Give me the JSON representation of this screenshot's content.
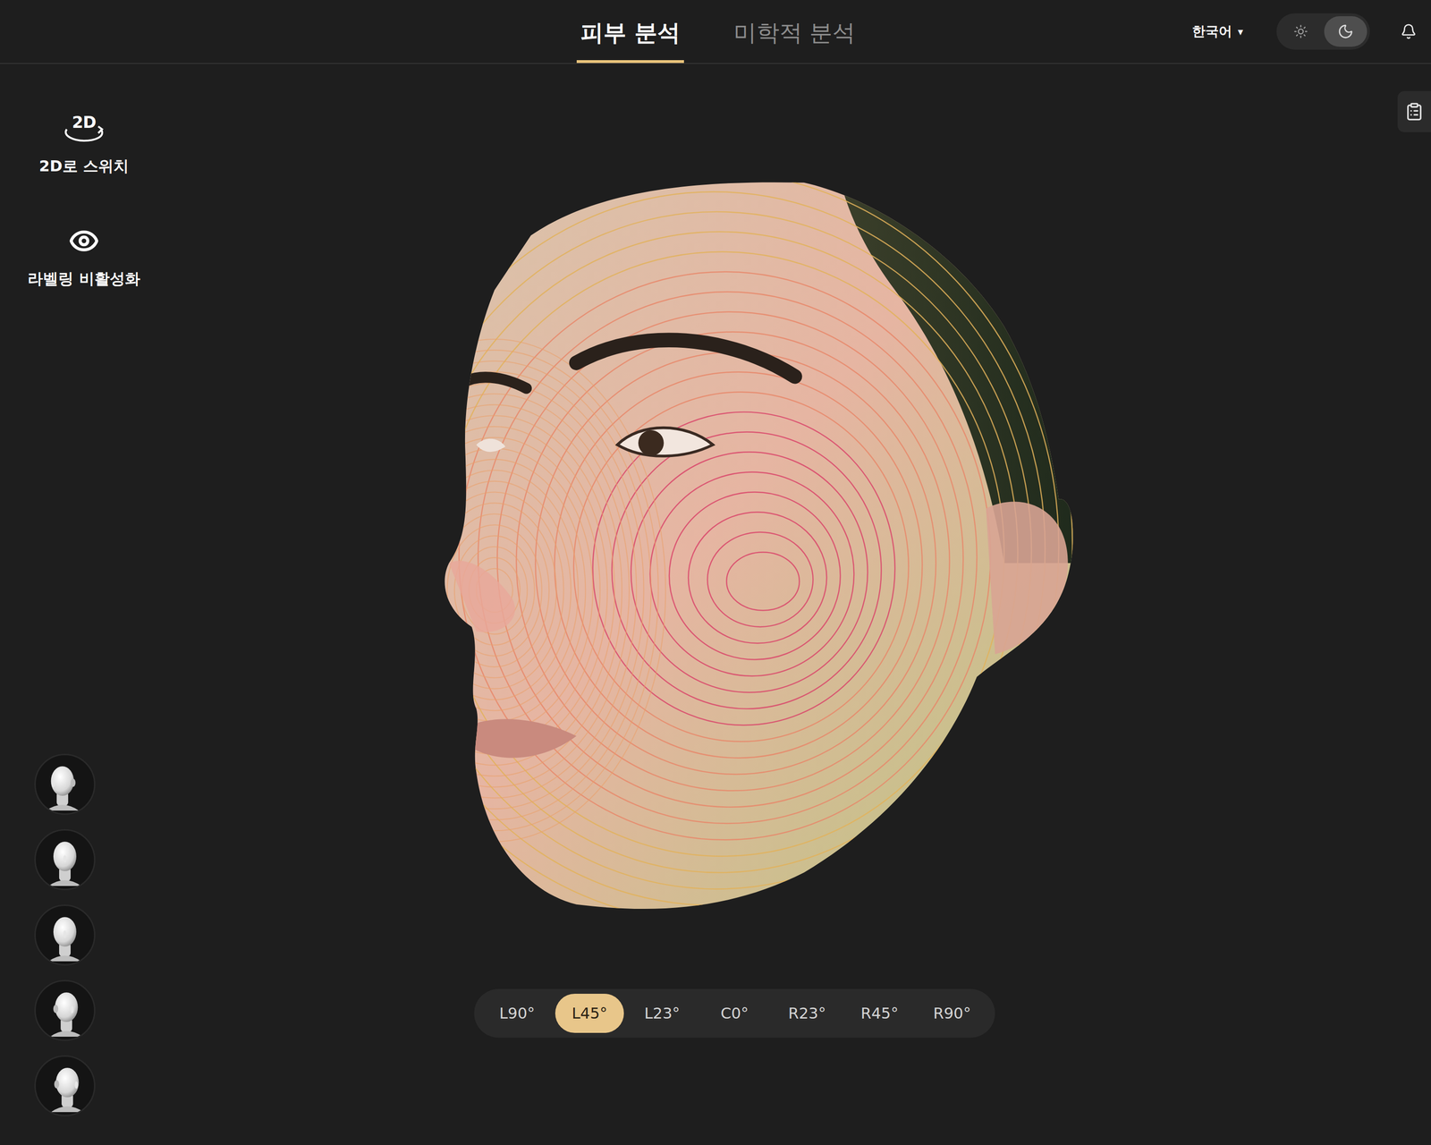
{
  "header": {
    "tabs": [
      {
        "label": "피부 분석",
        "selected": true
      },
      {
        "label": "미학적 분석",
        "selected": false
      }
    ],
    "language": {
      "label": "한국어",
      "caret": "▾"
    },
    "theme_toggle": [
      {
        "kind": "light",
        "selected": false
      },
      {
        "kind": "dark",
        "selected": true
      }
    ]
  },
  "sidebar": {
    "actions": [
      {
        "kind": "switch-2d",
        "icon_text": "2D",
        "label": "2D로 스위치"
      },
      {
        "kind": "labeling",
        "icon_text": "",
        "label": "라벨링 비활성화"
      }
    ]
  },
  "angles": [
    {
      "label": "L90°",
      "selected": false
    },
    {
      "label": "L45°",
      "selected": true
    },
    {
      "label": "L23°",
      "selected": false
    },
    {
      "label": "C0°",
      "selected": false
    },
    {
      "label": "R23°",
      "selected": false
    },
    {
      "label": "R45°",
      "selected": false
    },
    {
      "label": "R90°",
      "selected": false
    }
  ]
}
